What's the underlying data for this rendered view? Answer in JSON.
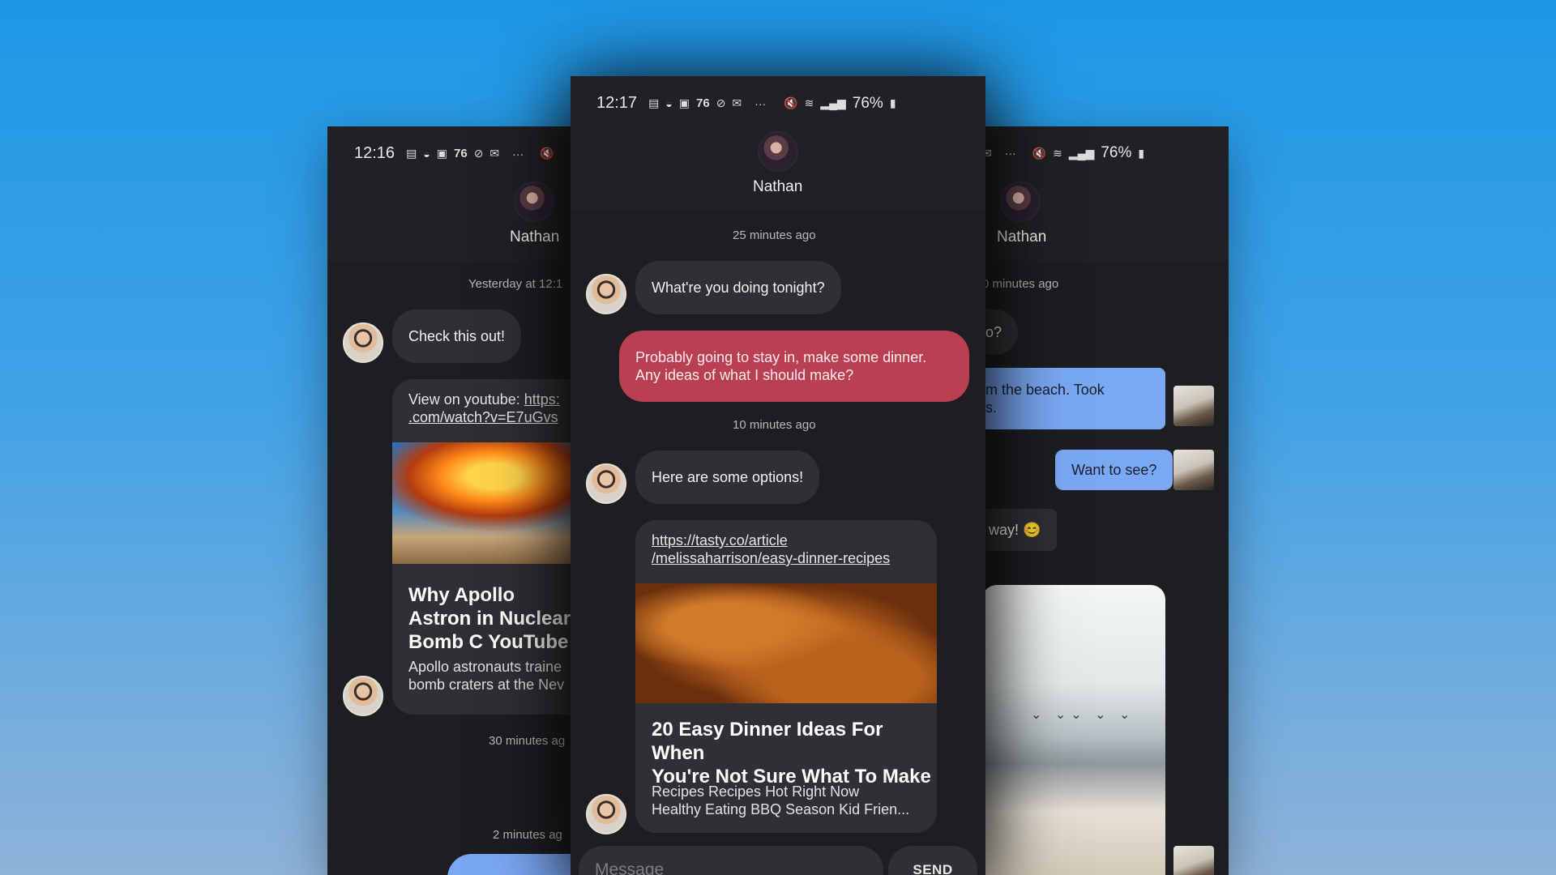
{
  "background": {
    "colors": [
      "#1d98e6",
      "#8fb3d9"
    ]
  },
  "left_phone": {
    "status": {
      "time": "12:16",
      "icons": [
        "message-icon",
        "game-icon",
        "save-icon"
      ],
      "badge": "76",
      "icons2": [
        "link-icon",
        "mail-icon"
      ],
      "more": "···"
    },
    "contact_name": "Nathan",
    "stamp1": "Yesterday at 12:1",
    "bubble1": "Check this out!",
    "card": {
      "link_prefix": "View on youtube: ",
      "link_url": "https:",
      "link_url2": ".com/watch?v=E7uGvs",
      "title": "Why Apollo Astron in Nuclear Bomb C YouTube",
      "desc": "Apollo astronauts traine bomb craters at the Nev"
    },
    "stamp2": "30 minutes ag",
    "stamp3": "2 minutes ag"
  },
  "center_phone": {
    "status": {
      "time": "12:17",
      "badge": "76",
      "more": "···",
      "battery": "76%"
    },
    "contact_name": "Nathan",
    "stamp1": "25 minutes ago",
    "msg1": "What're you doing tonight?",
    "msg2_line1": "Probably going to stay in, make some dinner.",
    "msg2_line2": "Any ideas of what I should make?",
    "stamp2": "10 minutes ago",
    "msg3": "Here are some options!",
    "card": {
      "link_line1": "https://tasty.co/article",
      "link_line2": "/melissaharrison/easy-dinner-recipes",
      "title_line1": "20 Easy Dinner Ideas For When",
      "title_line2": "You're Not Sure What To Make",
      "desc_line1": "Recipes Recipes Hot Right Now",
      "desc_line2": "Healthy Eating BBQ Season Kid Frien..."
    },
    "composer_placeholder": "Message",
    "send_label": "SEND"
  },
  "right_phone": {
    "status": {
      "more": "···",
      "battery": "76%"
    },
    "contact_name": "Nathan",
    "stamp1": "0 minutes ago",
    "bubble_q": "o?",
    "bubble_beach_line1": "om the beach. Took",
    "bubble_beach_line2": "os.",
    "bubble_see": "Want to see?",
    "bubble_way": "way! 😊"
  }
}
